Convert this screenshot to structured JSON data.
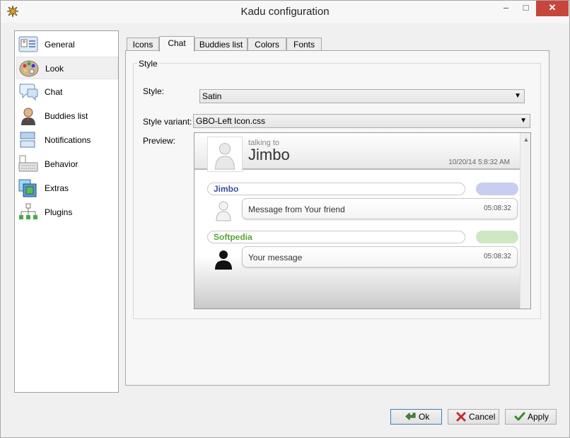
{
  "window": {
    "title": "Kadu configuration",
    "minimize": "–",
    "maximize": "□",
    "close": "✕"
  },
  "sidebar": {
    "items": [
      {
        "label": "General",
        "icon": "general-icon"
      },
      {
        "label": "Look",
        "icon": "look-icon",
        "selected": true
      },
      {
        "label": "Chat",
        "icon": "chat-icon"
      },
      {
        "label": "Buddies list",
        "icon": "buddies-icon"
      },
      {
        "label": "Notifications",
        "icon": "notifications-icon"
      },
      {
        "label": "Behavior",
        "icon": "behavior-icon"
      },
      {
        "label": "Extras",
        "icon": "extras-icon"
      },
      {
        "label": "Plugins",
        "icon": "plugins-icon"
      }
    ]
  },
  "tabs": [
    {
      "label": "Icons"
    },
    {
      "label": "Chat",
      "active": true
    },
    {
      "label": "Buddies list"
    },
    {
      "label": "Colors"
    },
    {
      "label": "Fonts"
    }
  ],
  "style_group": {
    "title": "Style",
    "style_label": "Style:",
    "style_value": "Satin",
    "variant_label": "Style variant:",
    "variant_value": "GBO-Left Icon.css",
    "preview_label": "Preview:"
  },
  "preview": {
    "talking_to": "talking to",
    "contact_name": "Jimbo",
    "date": "10/20/14 5:8:32 AM",
    "messages": [
      {
        "nick": "Jimbo",
        "text": "Message from Your friend",
        "time": "05:08:32",
        "nick_color": "#3b4fa0",
        "cloud_color": "#c9cdf0"
      },
      {
        "nick": "Softpedia",
        "text": "Your message",
        "time": "05:08:32",
        "nick_color": "#5aa53a",
        "cloud_color": "#cde8c2"
      }
    ]
  },
  "buttons": {
    "ok": "Ok",
    "cancel": "Cancel",
    "apply": "Apply"
  },
  "colors": {
    "close_button": "#c7463c",
    "window_bg": "#f0f0f0"
  }
}
